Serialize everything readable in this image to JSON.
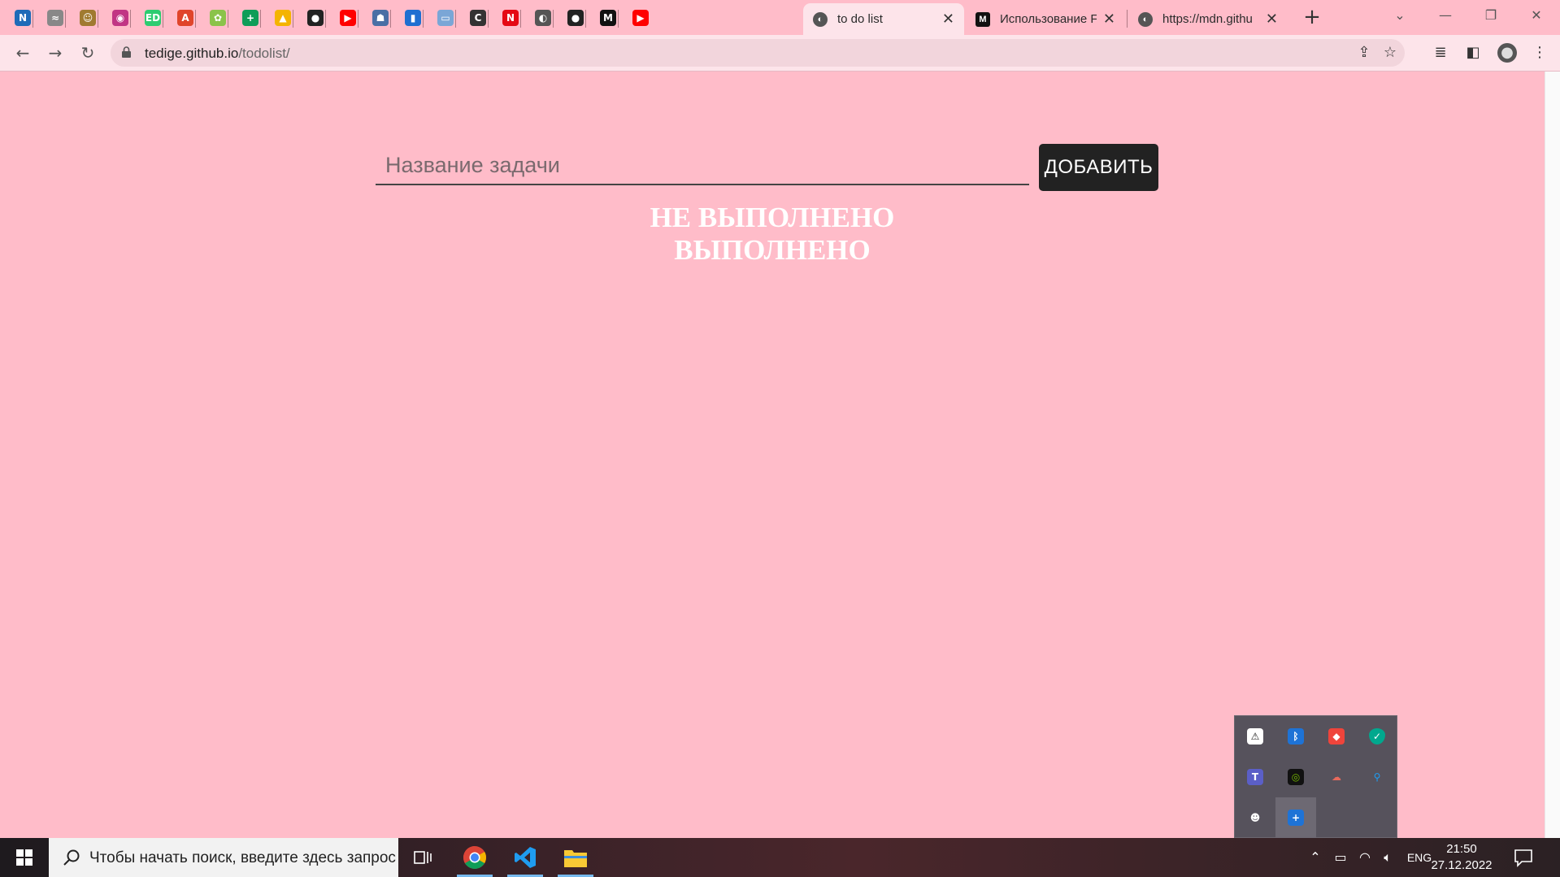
{
  "browser": {
    "pinned_tabs": [
      {
        "icon": "notion-icon",
        "glyph": "N",
        "color": "#1e6bb8"
      },
      {
        "icon": "zigzag-icon",
        "glyph": "≈",
        "color": "#888888"
      },
      {
        "icon": "bear-icon",
        "glyph": "☺",
        "color": "#a07a30"
      },
      {
        "icon": "instagram-icon",
        "glyph": "◉",
        "color": "#c13584"
      },
      {
        "icon": "edmodo-icon",
        "glyph": "ED",
        "color": "#2ecc71"
      },
      {
        "icon": "brave-icon",
        "glyph": "A",
        "color": "#e0452b"
      },
      {
        "icon": "apple-icon",
        "glyph": "✿",
        "color": "#8bc34a"
      },
      {
        "icon": "sheets-plus-icon",
        "glyph": "+",
        "color": "#0f9d58"
      },
      {
        "icon": "drive-icon",
        "glyph": "▲",
        "color": "#f4b400"
      },
      {
        "icon": "github-icon",
        "glyph": "●",
        "color": "#222222"
      },
      {
        "icon": "youtube-icon",
        "glyph": "▶",
        "color": "#ff0000"
      },
      {
        "icon": "robot-icon",
        "glyph": "☗",
        "color": "#4a6fa5"
      },
      {
        "icon": "book-icon",
        "glyph": "▮",
        "color": "#1f6fd1"
      },
      {
        "icon": "reader-icon",
        "glyph": "▭",
        "color": "#7aa6d6"
      },
      {
        "icon": "codewars-icon",
        "glyph": "C",
        "color": "#333333"
      },
      {
        "icon": "netflix-icon",
        "glyph": "N",
        "color": "#e50914"
      },
      {
        "icon": "globe-icon",
        "glyph": "◐",
        "color": "#555555"
      },
      {
        "icon": "github-icon",
        "glyph": "●",
        "color": "#222222"
      },
      {
        "icon": "medium-icon",
        "glyph": "M",
        "color": "#111111"
      },
      {
        "icon": "youtube-icon",
        "glyph": "▶",
        "color": "#ff0000"
      }
    ],
    "tabs": [
      {
        "title": "to do list",
        "active": true
      },
      {
        "title": "Использование F",
        "active": false
      },
      {
        "title": "https://mdn.githu",
        "active": false
      }
    ],
    "url_host": "tedige.github.io",
    "url_path": "/todolist/"
  },
  "page": {
    "input_placeholder": "Название задачи",
    "input_value": "",
    "add_button_label": "ДОБАВИТЬ",
    "section_not_done": "НЕ ВЫПОЛНЕНО",
    "section_done": "ВЫПОЛНЕНО",
    "background_color": "#ffbcc9"
  },
  "taskbar": {
    "search_placeholder": "Чтобы начать поиск, введите здесь запрос",
    "language": "ENG",
    "time": "21:50",
    "date": "27.12.2022",
    "tray_icons": [
      "security-warning-icon",
      "bluetooth-icon",
      "anydesk-icon",
      "kaspersky-icon",
      "teams-icon",
      "nvidia-icon",
      "cloud-sync-icon",
      "location-pin-icon",
      "discord-icon",
      "add-app-icon"
    ]
  }
}
